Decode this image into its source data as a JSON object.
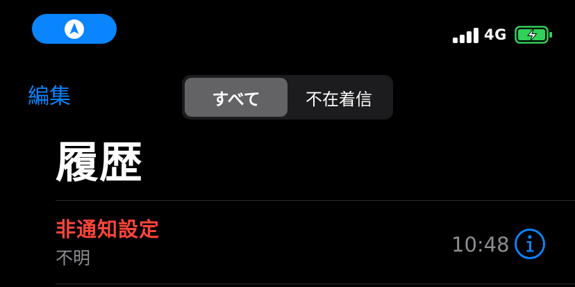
{
  "status_bar": {
    "network": "4G",
    "nav_pill_icon": "location-arrow-icon",
    "battery_state": "charging",
    "colors": {
      "pill": "#0a84ff",
      "battery_fill": "#30d158"
    }
  },
  "header": {
    "edit_label": "編集",
    "segments": [
      {
        "label": "すべて",
        "selected": true
      },
      {
        "label": "不在着信",
        "selected": false
      }
    ]
  },
  "title": "履歴",
  "calls": [
    {
      "name": "非通知設定",
      "type": "不明",
      "time": "10:48",
      "info_icon": "info-circle-icon"
    }
  ],
  "colors": {
    "accent": "#0a84ff",
    "missed": "#ff453a",
    "secondary_text": "#8e8e93",
    "background": "#000000"
  }
}
